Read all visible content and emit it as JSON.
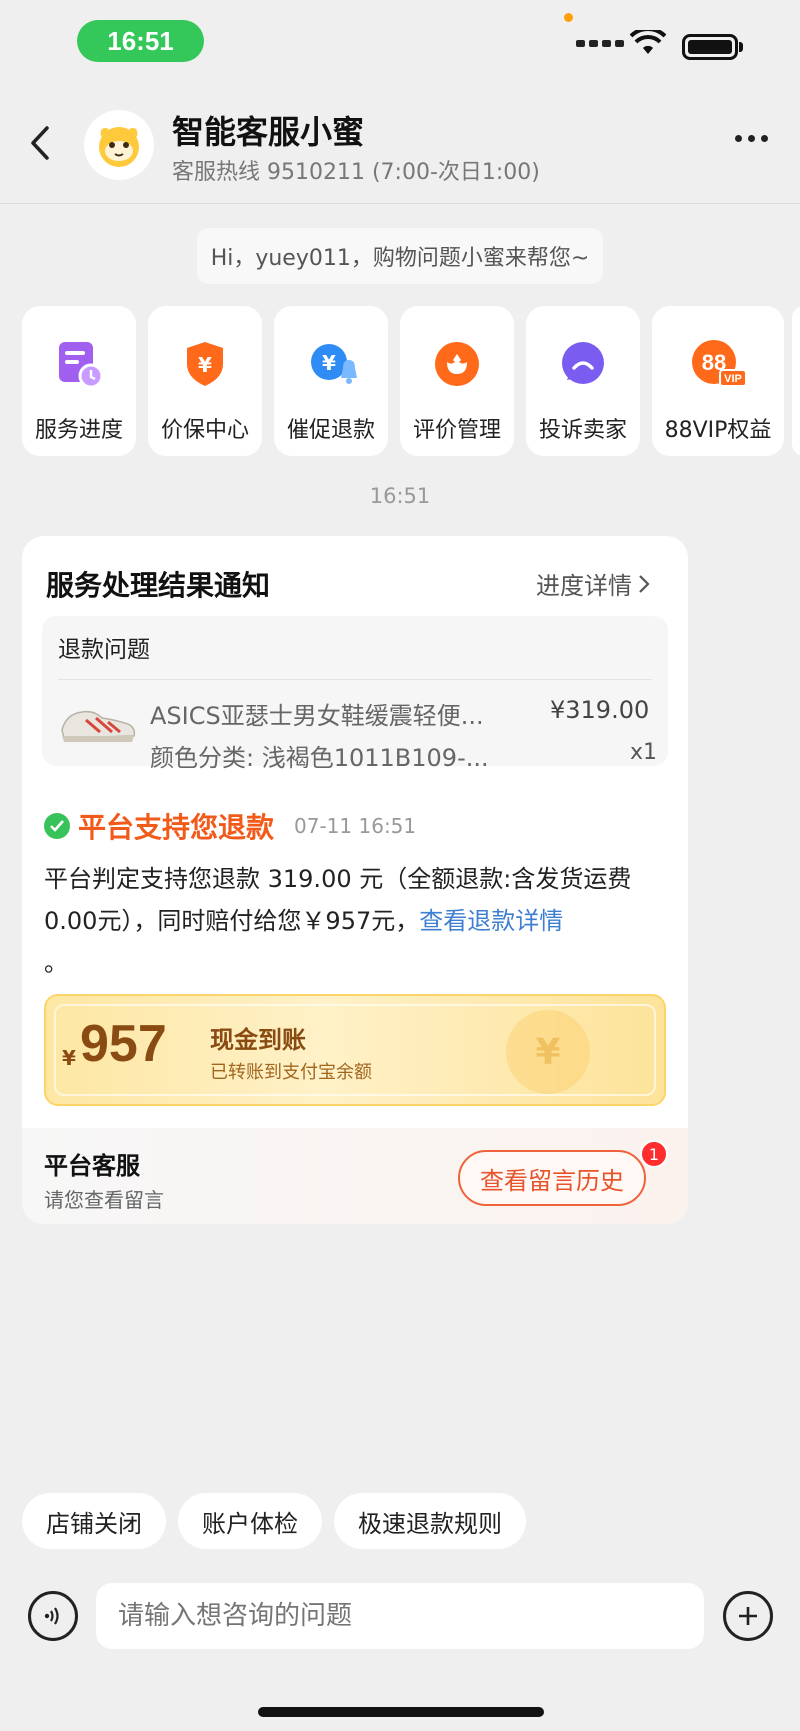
{
  "status_bar": {
    "time": "16:51"
  },
  "header": {
    "title": "智能客服小蜜",
    "hotline": "客服热线 9510211 (7:00-次日1:00)"
  },
  "greeting": "Hi，yuey011，购物问题小蜜来帮您~",
  "services": [
    {
      "label": "服务进度",
      "icon": "schedule-icon",
      "color": "#a15ff0"
    },
    {
      "label": "价保中心",
      "icon": "price-shield-icon",
      "color": "#ff6a1a"
    },
    {
      "label": "催促退款",
      "icon": "refund-bell-icon",
      "color": "#2f8cf5"
    },
    {
      "label": "评价管理",
      "icon": "flower-icon",
      "color": "#ff6a1a"
    },
    {
      "label": "投诉卖家",
      "icon": "complaint-icon",
      "color": "#7a5cf0"
    },
    {
      "label": "88VIP权益",
      "icon": "vip-icon",
      "color": "#ff6a1a"
    }
  ],
  "chat_time": "16:51",
  "card": {
    "title": "服务处理结果通知",
    "detail_link": "进度详情",
    "issue_title": "退款问题",
    "product": {
      "name": "ASICS亚瑟士男女鞋缓震轻便...",
      "spec": "颜色分类: 浅褐色1011B109-...",
      "price": "¥319.00",
      "qty": "x1"
    },
    "status": "平台支持您退款",
    "status_time": "07-11 16:51",
    "desc_main": "平台判定支持您退款 319.00 元（全额退款:含发货运费0.00元），同时赔付给您￥957元，",
    "desc_link": "查看退款详情",
    "desc_end": "。",
    "cash": {
      "currency": "¥",
      "amount": "957",
      "title": "现金到账",
      "subtitle": "已转账到支付宝余额"
    },
    "footer_title": "平台客服",
    "footer_sub": "请您查看留言",
    "history_button": "查看留言历史",
    "badge_count": "1"
  },
  "quick_replies": [
    "店铺关闭",
    "账户体检",
    "极速退款规则"
  ],
  "input": {
    "placeholder": "请输入想咨询的问题"
  }
}
